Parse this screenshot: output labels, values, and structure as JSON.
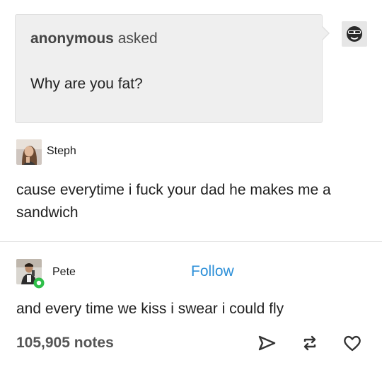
{
  "ask": {
    "asker": "anonymous",
    "verb": " asked",
    "question": "Why are you fat?"
  },
  "reply1": {
    "username": "Steph",
    "text": "cause everytime i fuck your dad he makes me a sandwich"
  },
  "reply2": {
    "username": "Pete",
    "follow_label": "Follow",
    "text": "and every time we kiss i swear i could fly"
  },
  "footer": {
    "notes": "105,905 notes",
    "icons": [
      "share-icon",
      "reblog-icon",
      "like-icon"
    ]
  },
  "colors": {
    "ask_background": "#efefef",
    "follow_link": "#2c8fd8",
    "badge_green": "#2fbf4a"
  }
}
